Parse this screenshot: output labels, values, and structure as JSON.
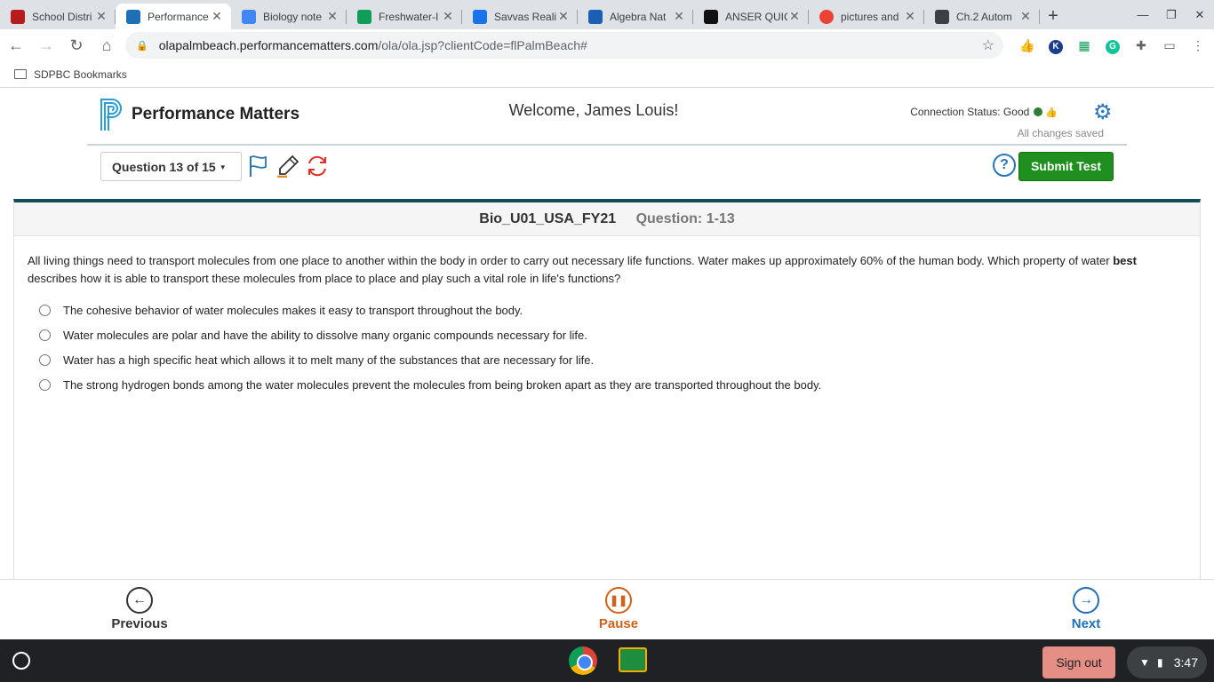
{
  "browser": {
    "tabs": [
      {
        "title": "School Distri",
        "favicon_color": "#b71c1c"
      },
      {
        "title": "Performance",
        "favicon_color": "#1e6fb5",
        "active": true
      },
      {
        "title": "Biology note",
        "favicon_color": "#4285f4"
      },
      {
        "title": "Freshwater-I",
        "favicon_color": "#0f9d58"
      },
      {
        "title": "Savvas Reali",
        "favicon_color": "#1a73e8"
      },
      {
        "title": "Algebra Nat",
        "favicon_color": "#1a5fb4"
      },
      {
        "title": "ANSER QUIC",
        "favicon_color": "#111111"
      },
      {
        "title": "pictures and",
        "favicon_color": "#ea4335"
      },
      {
        "title": "Ch.2 Autom",
        "favicon_color": "#3c4043"
      }
    ],
    "url_host": "olapalmbeach.performancematters.com",
    "url_path": "/ola/ola.jsp?clientCode=flPalmBeach#",
    "bookmark_folder": "SDPBC Bookmarks"
  },
  "header": {
    "brand": "Performance Matters",
    "welcome": "Welcome, James Louis!",
    "connection_status": "Connection Status: Good",
    "saved_status": "All changes saved",
    "question_selector": "Question 13 of 15",
    "submit_label": "Submit Test",
    "help_label": "?"
  },
  "question": {
    "test_name": "Bio_U01_USA_FY21",
    "question_number": "Question: 1-13",
    "stem_part1": "All living things need to transport molecules from one place to another within the body in order to carry out necessary life functions. Water makes up approximately 60% of the human body.  Which property of water ",
    "stem_bold": "best",
    "stem_part2": " describes how it is able to transport these molecules from place to place and play such a vital role in life's functions?",
    "choices": [
      "The cohesive behavior of water molecules makes it easy to transport throughout the body.",
      "Water molecules are polar and have the ability to dissolve many organic compounds necessary for life.",
      "Water has a high specific heat which allows it to melt many of the substances that are necessary for life.",
      "The strong hydrogen bonds among the water molecules prevent the molecules from being broken apart as they are transported throughout the body."
    ]
  },
  "footer": {
    "previous": "Previous",
    "pause": "Pause",
    "next": "Next",
    "previous_color": "#333333",
    "pause_color": "#d2601a",
    "next_color": "#1e6fb5"
  },
  "shelf": {
    "sign_out": "Sign out",
    "time": "3:47"
  },
  "colors": {
    "submit_green": "#1f8f1f",
    "brand_blue": "#2a74b8",
    "question_bar": "#0f4c5c"
  }
}
